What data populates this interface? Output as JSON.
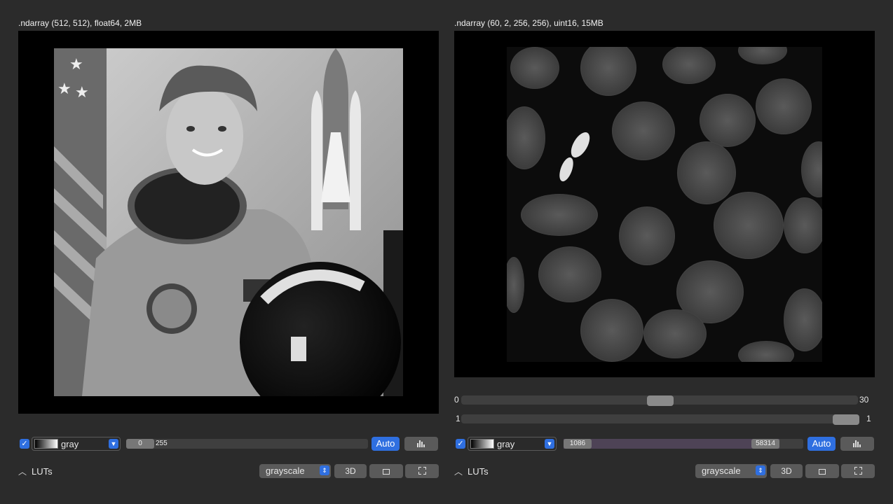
{
  "left_viewer": {
    "info": ".ndarray (512, 512), float64, 2MB",
    "image": "astronaut photograph",
    "channel": {
      "checked": true,
      "lut_name": "gray",
      "range_min": "0",
      "range_max": "255",
      "auto_label": "Auto"
    },
    "luts_label": "LUTs",
    "colormap_value": "grayscale",
    "btn_3d": "3D"
  },
  "right_viewer": {
    "info": ".ndarray (60, 2, 256, 256), uint16, 15MB",
    "image": "fluorescent cell nuclei",
    "dims": [
      {
        "label_left": "0",
        "label_right": "30",
        "value_fraction": 0.5
      },
      {
        "label_left": "1",
        "label_right": "1",
        "value_fraction": 1.0
      }
    ],
    "channel": {
      "checked": true,
      "lut_name": "gray",
      "range_min": "1086",
      "range_max": "58314",
      "auto_label": "Auto"
    },
    "luts_label": "LUTs",
    "colormap_value": "grayscale",
    "btn_3d": "3D"
  },
  "icons": {
    "histogram": "histogram-icon",
    "roi": "roi-icon",
    "fullscreen": "fullscreen-icon",
    "checkbox": "checkmark-icon",
    "dropdown": "chevron-down-icon",
    "collapse": "chevron-up-icon"
  }
}
